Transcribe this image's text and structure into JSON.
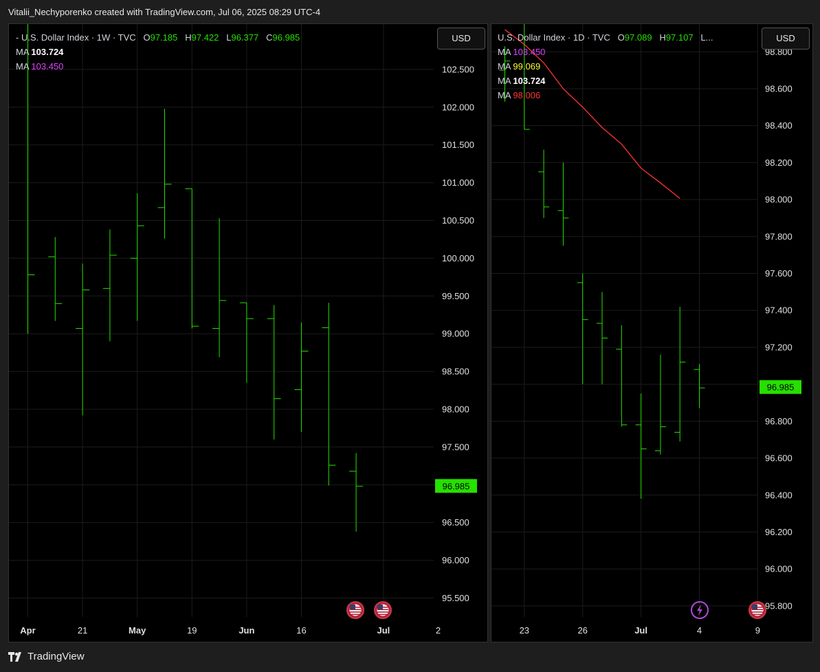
{
  "header": {
    "text": "Vitalii_Nechyporenko created with TradingView.com, Jul 06, 2025 08:29 UTC-4"
  },
  "footer": {
    "brand": "TradingView",
    "logo_icon": "tradingview-logo-icon"
  },
  "colors": {
    "bar": "#26e000",
    "grid": "#1c1c1c",
    "price_tag": "#26e000",
    "ma_white": "#ffffff",
    "ma_magenta": "#e040fb",
    "ma_yellow": "#ffff33",
    "ma_red": "#ff3333"
  },
  "chart_data": [
    {
      "type": "ohlc",
      "symbol": "U.S. Dollar Index",
      "interval": "1W",
      "source": "TVC",
      "legend": {
        "o": "97.185",
        "h": "97.422",
        "l": "96.377",
        "c": "96.985"
      },
      "ma": [
        {
          "label": "MA",
          "value": "103.724",
          "color": "#ffffff"
        },
        {
          "label": "MA",
          "value": "103.450",
          "color": "#e040fb"
        }
      ],
      "currency_button": "USD",
      "last_price": "96.985",
      "y_ticks": [
        "102.500",
        "102.000",
        "101.500",
        "101.000",
        "100.500",
        "100.000",
        "99.500",
        "99.000",
        "98.500",
        "98.000",
        "97.500",
        "97.000",
        "96.500",
        "96.000",
        "95.500"
      ],
      "ylim": [
        95.25,
        103.1
      ],
      "x_labels": [
        {
          "label": "Apr",
          "bar": 0,
          "bold": true
        },
        {
          "label": "21",
          "bar": 2
        },
        {
          "label": "May",
          "bar": 4,
          "bold": true
        },
        {
          "label": "19",
          "bar": 6
        },
        {
          "label": "Jun",
          "bar": 8,
          "bold": true
        },
        {
          "label": "16",
          "bar": 10
        },
        {
          "label": "Jul",
          "bar": 13,
          "bold": true
        },
        {
          "label": "2",
          "bar": 15
        }
      ],
      "bars": [
        {
          "o": 104.2,
          "h": 104.7,
          "l": 99.0,
          "c": 99.78
        },
        {
          "o": 100.02,
          "h": 100.28,
          "l": 99.17,
          "c": 99.4
        },
        {
          "o": 99.07,
          "h": 99.93,
          "l": 97.92,
          "c": 99.58
        },
        {
          "o": 99.6,
          "h": 100.38,
          "l": 98.9,
          "c": 100.04
        },
        {
          "o": 100.0,
          "h": 100.86,
          "l": 99.17,
          "c": 100.43
        },
        {
          "o": 100.67,
          "h": 101.98,
          "l": 100.26,
          "c": 100.98
        },
        {
          "o": 100.92,
          "h": 100.92,
          "l": 99.07,
          "c": 99.1
        },
        {
          "o": 99.07,
          "h": 100.53,
          "l": 98.69,
          "c": 99.44
        },
        {
          "o": 99.41,
          "h": 99.41,
          "l": 98.35,
          "c": 99.2
        },
        {
          "o": 99.2,
          "h": 99.38,
          "l": 97.6,
          "c": 98.14
        },
        {
          "o": 98.26,
          "h": 99.15,
          "l": 97.7,
          "c": 98.77
        },
        {
          "o": 99.08,
          "h": 99.41,
          "l": 96.99,
          "c": 97.26
        },
        {
          "o": 97.18,
          "h": 97.42,
          "l": 96.38,
          "c": 96.98
        }
      ],
      "events": [
        "us-flag-icon",
        "us-flag-icon"
      ]
    },
    {
      "type": "ohlc",
      "symbol": "U.S. Dollar Index",
      "interval": "1D",
      "source": "TVC",
      "legend": {
        "o": "97.089",
        "h": "97.107",
        "tail": "L..."
      },
      "ma": [
        {
          "label": "MA",
          "value": "103.450",
          "color": "#e040fb"
        },
        {
          "label": "MA",
          "value": "99.069",
          "color": "#ffff33"
        },
        {
          "label": "MA",
          "value": "103.724",
          "color": "#ffffff"
        },
        {
          "label": "MA",
          "value": "98.006",
          "color": "#ff3333"
        }
      ],
      "currency_button": "USD",
      "last_price": "96.985",
      "y_ticks": [
        "98.800",
        "98.600",
        "98.400",
        "98.200",
        "98.000",
        "97.800",
        "97.600",
        "97.400",
        "97.200",
        "97.000",
        "96.800",
        "96.600",
        "96.400",
        "96.200",
        "96.000",
        "95.800"
      ],
      "ylim": [
        95.74,
        98.95
      ],
      "x_labels": [
        {
          "label": "23",
          "bar": 1
        },
        {
          "label": "26",
          "bar": 4
        },
        {
          "label": "Jul",
          "bar": 7,
          "bold": true
        },
        {
          "label": "4",
          "bar": 10
        },
        {
          "label": "9",
          "bar": 13
        }
      ],
      "bars": [
        {
          "o": 98.7,
          "h": 98.83,
          "l": 98.53,
          "c": 98.75
        },
        {
          "o": 99.1,
          "h": 99.3,
          "l": 98.38,
          "c": 98.38
        },
        {
          "o": 98.15,
          "h": 98.27,
          "l": 97.9,
          "c": 97.96
        },
        {
          "o": 97.94,
          "h": 98.2,
          "l": 97.75,
          "c": 97.9
        },
        {
          "o": 97.55,
          "h": 97.6,
          "l": 97.0,
          "c": 97.35
        },
        {
          "o": 97.33,
          "h": 97.5,
          "l": 97.0,
          "c": 97.25
        },
        {
          "o": 97.19,
          "h": 97.32,
          "l": 96.77,
          "c": 96.78
        },
        {
          "o": 96.78,
          "h": 96.95,
          "l": 96.38,
          "c": 96.65
        },
        {
          "o": 96.64,
          "h": 97.16,
          "l": 96.62,
          "c": 96.77
        },
        {
          "o": 96.74,
          "h": 97.42,
          "l": 96.69,
          "c": 97.12
        },
        {
          "o": 97.08,
          "h": 97.11,
          "l": 96.87,
          "c": 96.98
        }
      ],
      "ma_line": {
        "color": "#ff3333",
        "values": [
          98.92,
          98.84,
          98.74,
          98.6,
          98.5,
          98.39,
          98.3,
          98.17,
          98.09,
          98.006
        ]
      },
      "events": [
        "lightning-icon",
        "us-flag-icon"
      ]
    }
  ]
}
